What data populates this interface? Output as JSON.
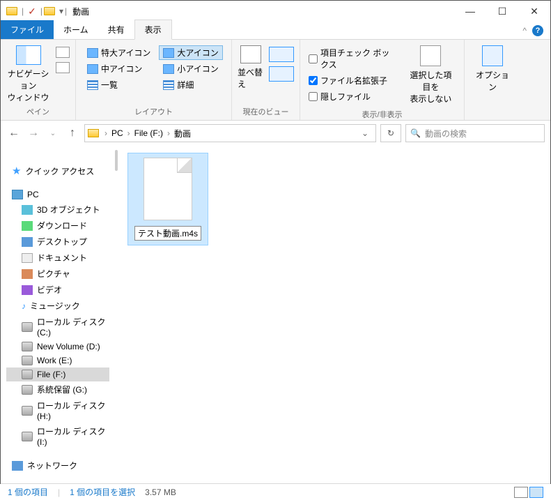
{
  "window": {
    "title": "動画"
  },
  "tabs": {
    "file": "ファイル",
    "home": "ホーム",
    "share": "共有",
    "view": "表示"
  },
  "ribbon": {
    "pane": {
      "nav": "ナビゲーション\nウィンドウ",
      "label": "ペイン"
    },
    "layouts": {
      "xl": "特大アイコン",
      "lg": "大アイコン",
      "md": "中アイコン",
      "sm": "小アイコン",
      "list": "一覧",
      "detail": "詳細",
      "label": "レイアウト"
    },
    "sort": {
      "btn": "並べ替え",
      "label": "現在のビュー"
    },
    "showhide": {
      "checkboxes": "項目チェック ボックス",
      "ext": "ファイル名拡張子",
      "hidden": "隠しファイル",
      "hide_sel": "選択した項目を\n表示しない",
      "label": "表示/非表示"
    },
    "options": "オプション"
  },
  "breadcrumb": {
    "pc": "PC",
    "drive": "File (F:)",
    "folder": "動画"
  },
  "search": {
    "placeholder": "動画の検索"
  },
  "tree": {
    "quick": "クイック アクセス",
    "pc": "PC",
    "3d": "3D オブジェクト",
    "dl": "ダウンロード",
    "desktop": "デスクトップ",
    "docs": "ドキュメント",
    "pics": "ピクチャ",
    "video": "ビデオ",
    "music": "ミュージック",
    "diskC": "ローカル ディスク (C:)",
    "diskD": "New Volume (D:)",
    "diskE": "Work (E:)",
    "diskF": "File (F:)",
    "diskG": "系統保留 (G:)",
    "diskH": "ローカル ディスク (H:)",
    "diskI": "ローカル ディスク (I:)",
    "network": "ネットワーク"
  },
  "files": {
    "item1": "テスト動画.m4s"
  },
  "status": {
    "count": "1 個の項目",
    "selected": "1 個の項目を選択",
    "size": "3.57 MB"
  }
}
